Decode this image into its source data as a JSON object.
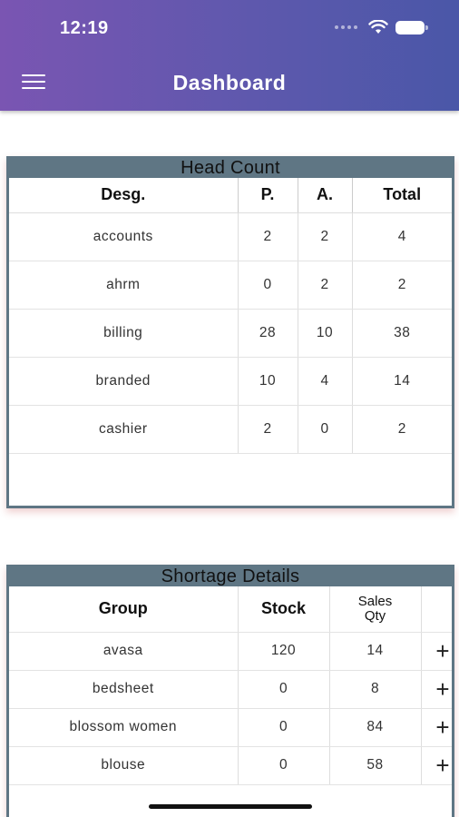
{
  "status_bar": {
    "time": "12:19"
  },
  "header": {
    "title": "Dashboard"
  },
  "head_count": {
    "title": "Head Count",
    "columns": [
      "Desg.",
      "P.",
      "A.",
      "Total"
    ],
    "rows": [
      [
        "accounts",
        "2",
        "2",
        "4"
      ],
      [
        "ahrm",
        "0",
        "2",
        "2"
      ],
      [
        "billing",
        "28",
        "10",
        "38"
      ],
      [
        "branded",
        "10",
        "4",
        "14"
      ],
      [
        "cashier",
        "2",
        "0",
        "2"
      ]
    ]
  },
  "shortage_details": {
    "title": "Shortage Details",
    "columns": [
      "Group",
      "Stock",
      "Sales",
      "Qty"
    ],
    "rows": [
      [
        "avasa",
        "120",
        "14"
      ],
      [
        "bedsheet",
        "0",
        "8"
      ],
      [
        "blossom women",
        "0",
        "84"
      ],
      [
        "blouse",
        "0",
        "58"
      ]
    ],
    "expand_symbol": "+"
  },
  "icons": [
    "menu-icon",
    "wifi-icon",
    "battery-icon",
    "plus-icon"
  ]
}
